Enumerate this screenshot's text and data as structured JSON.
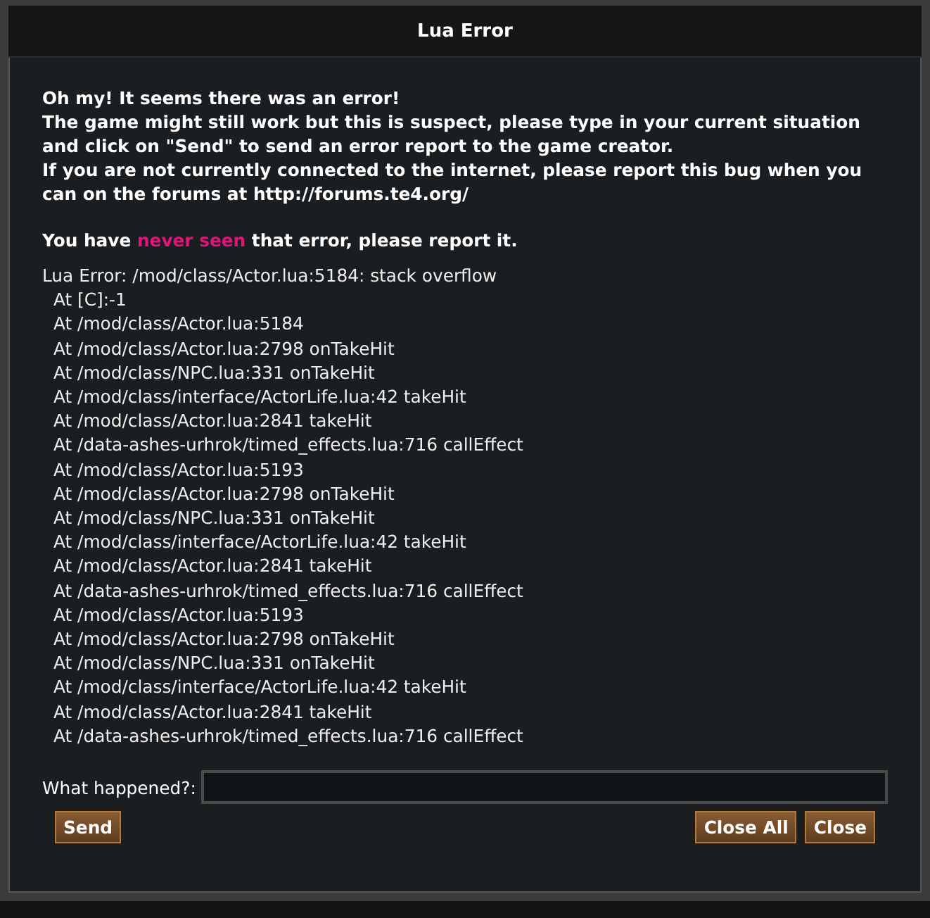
{
  "window": {
    "title": "Lua Error"
  },
  "intro_lines": [
    "Oh my! It seems there was an error!",
    "The game might still work but this is suspect, please type in your current situation",
    "and click on \"Send\" to send an error report to the game creator.",
    "If you are not currently connected to the internet, please report this bug when you",
    "can on the forums at http://forums.te4.org/"
  ],
  "notice": {
    "parts": [
      {
        "text": "You have ",
        "highlighted": false
      },
      {
        "text": "never seen",
        "highlighted": true
      },
      {
        "text": " that error, please report it.",
        "highlighted": false
      }
    ]
  },
  "trace": {
    "header": "Lua Error: /mod/class/Actor.lua:5184: stack overflow",
    "lines": [
      "At [C]:-1",
      "At /mod/class/Actor.lua:5184",
      "At /mod/class/Actor.lua:2798 onTakeHit",
      "At /mod/class/NPC.lua:331 onTakeHit",
      "At /mod/class/interface/ActorLife.lua:42 takeHit",
      "At /mod/class/Actor.lua:2841 takeHit",
      "At /data-ashes-urhrok/timed_effects.lua:716 callEffect",
      "At /mod/class/Actor.lua:5193",
      "At /mod/class/Actor.lua:2798 onTakeHit",
      "At /mod/class/NPC.lua:331 onTakeHit",
      "At /mod/class/interface/ActorLife.lua:42 takeHit",
      "At /mod/class/Actor.lua:2841 takeHit",
      "At /data-ashes-urhrok/timed_effects.lua:716 callEffect",
      "At /mod/class/Actor.lua:5193",
      "At /mod/class/Actor.lua:2798 onTakeHit",
      "At /mod/class/NPC.lua:331 onTakeHit",
      "At /mod/class/interface/ActorLife.lua:42 takeHit",
      "At /mod/class/Actor.lua:2841 takeHit",
      "At /data-ashes-urhrok/timed_effects.lua:716 callEffect"
    ]
  },
  "report_field": {
    "label": "What happened?:"
  },
  "buttons_left": [
    "Send"
  ],
  "buttons_right": [
    "Close All",
    "Close"
  ]
}
